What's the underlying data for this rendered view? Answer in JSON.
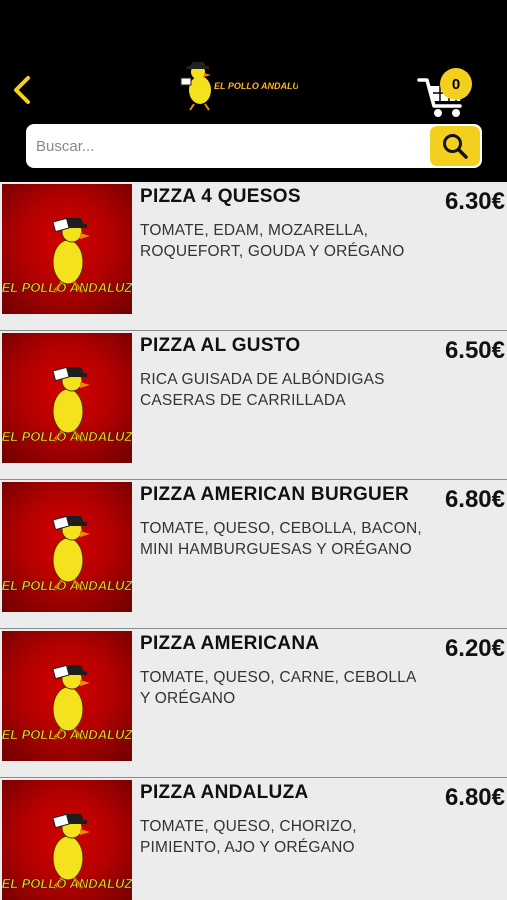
{
  "header": {
    "logo_text": "EL POLLO ANDALUZ",
    "cart_count": "0",
    "colors": {
      "background": "#000000",
      "accent": "#f4d01e"
    }
  },
  "search": {
    "placeholder": "Buscar...",
    "value": ""
  },
  "products": [
    {
      "name": "PIZZA 4 QUESOS",
      "description": "TOMATE, EDAM, MOZARELLA, ROQUEFORT, GOUDA Y ORÉGANO",
      "price": "6.30€",
      "image_text": "EL POLLO ANDALUZ"
    },
    {
      "name": "PIZZA AL GUSTO",
      "description": "RICA GUISADA DE ALBÓNDIGAS CASERAS DE CARRILLADA",
      "price": "6.50€",
      "image_text": "EL POLLO ANDALUZ"
    },
    {
      "name": "PIZZA AMERICAN BURGUER",
      "description": "TOMATE, QUESO, CEBOLLA, BACON, MINI HAMBURGUESAS Y ORÉGANO",
      "price": "6.80€",
      "image_text": "EL POLLO ANDALUZ"
    },
    {
      "name": "PIZZA AMERICANA",
      "description": "TOMATE, QUESO, CARNE, CEBOLLA Y ORÉGANO",
      "price": "6.20€",
      "image_text": "EL POLLO ANDALUZ"
    },
    {
      "name": "PIZZA ANDALUZA",
      "description": "TOMATE, QUESO, CHORIZO, PIMIENTO, AJO Y ORÉGANO",
      "price": "6.80€",
      "image_text": "EL POLLO ANDALUZ"
    }
  ],
  "icons": {
    "back": "chevron-left-icon",
    "cart": "shopping-cart-icon",
    "search": "search-icon"
  }
}
